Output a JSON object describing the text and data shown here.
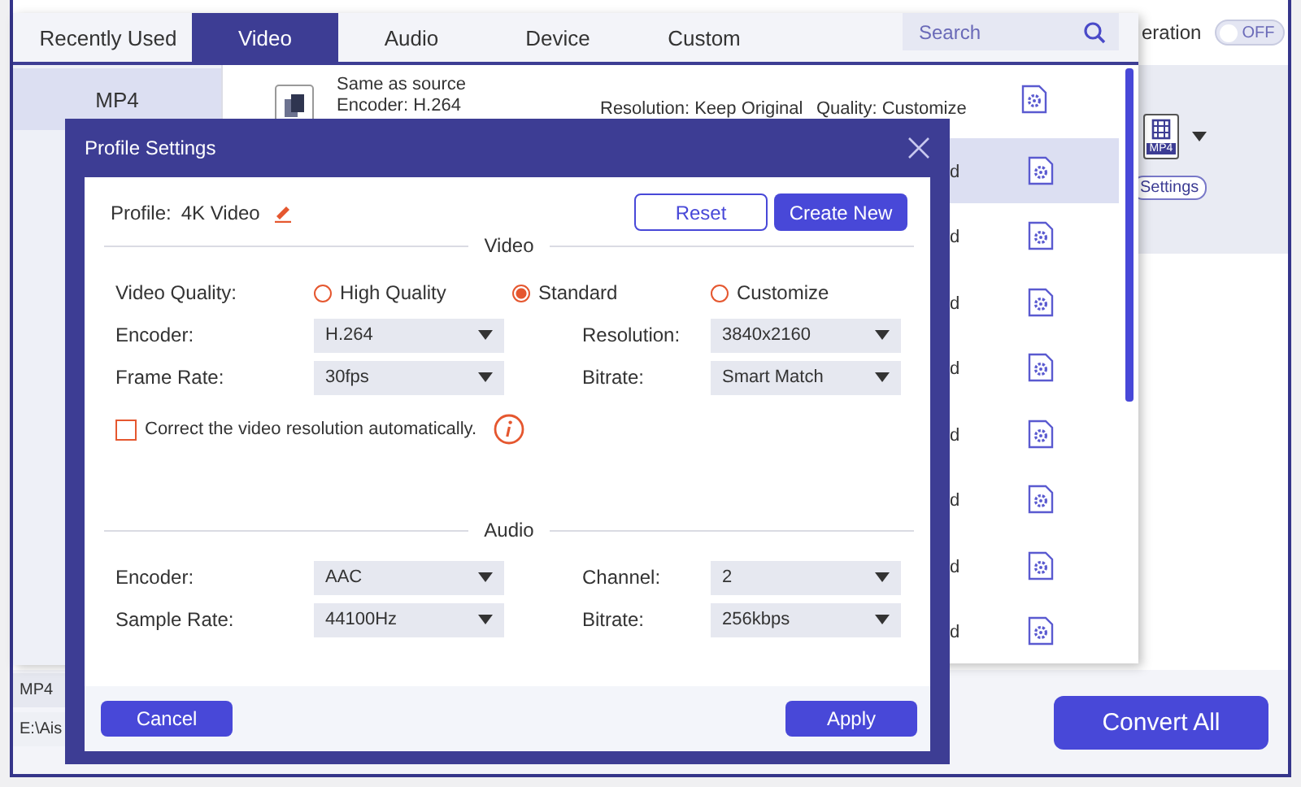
{
  "app": {
    "toggle_label": "eration",
    "toggle": {
      "text": "OFF",
      "on": false
    },
    "format_badge": "MP4",
    "settings_button": "Settings",
    "convert_button": "Convert All",
    "output_format": "MP4",
    "save_path": "E:\\Ais"
  },
  "format_popup": {
    "tabs": [
      {
        "label": "Recently Used",
        "selected": false
      },
      {
        "label": "Video",
        "selected": true
      },
      {
        "label": "Audio",
        "selected": false
      },
      {
        "label": "Device",
        "selected": false
      },
      {
        "label": "Custom",
        "selected": false
      }
    ],
    "search": {
      "placeholder": "Search"
    },
    "formats": [
      {
        "label": "MP4",
        "selected": true
      }
    ],
    "profiles": [
      {
        "title": "Same as source",
        "encoder": "Encoder: H.264",
        "resolution": "Resolution: Keep Original",
        "quality": "Quality: Customize",
        "selected": false
      },
      {
        "quality": "d",
        "selected": true
      },
      {
        "quality": "d",
        "selected": false
      },
      {
        "quality": "d",
        "selected": false
      },
      {
        "quality": "d",
        "selected": false
      },
      {
        "quality": "d",
        "selected": false
      },
      {
        "quality": "d",
        "selected": false
      },
      {
        "quality": "d",
        "selected": false
      },
      {
        "quality": "d",
        "selected": false
      }
    ]
  },
  "dialog": {
    "title": "Profile Settings",
    "profile_label": "Profile:",
    "profile_name": "4K Video",
    "reset_button": "Reset",
    "create_button": "Create New",
    "sections": [
      {
        "title": "Video",
        "rows": [
          {
            "kind": "radio",
            "label": "Video Quality:",
            "options": [
              {
                "label": "High Quality",
                "selected": false
              },
              {
                "label": "Standard",
                "selected": true
              },
              {
                "label": "Customize",
                "selected": false
              }
            ]
          },
          {
            "kind": "selects",
            "fields": [
              {
                "label": "Encoder:",
                "value": "H.264"
              },
              {
                "label": "Resolution:",
                "value": "3840x2160"
              }
            ]
          },
          {
            "kind": "selects",
            "fields": [
              {
                "label": "Frame Rate:",
                "value": "30fps"
              },
              {
                "label": "Bitrate:",
                "value": "Smart Match"
              }
            ]
          },
          {
            "kind": "checkbox",
            "label": "Correct the video resolution automatically.",
            "checked": false
          }
        ]
      },
      {
        "title": "Audio",
        "rows": [
          {
            "kind": "selects",
            "fields": [
              {
                "label": "Encoder:",
                "value": "AAC"
              },
              {
                "label": "Channel:",
                "value": "2"
              }
            ]
          },
          {
            "kind": "selects",
            "fields": [
              {
                "label": "Sample Rate:",
                "value": "44100Hz"
              },
              {
                "label": "Bitrate:",
                "value": "256kbps"
              }
            ]
          }
        ]
      }
    ],
    "cancel_button": "Cancel",
    "apply_button": "Apply"
  }
}
